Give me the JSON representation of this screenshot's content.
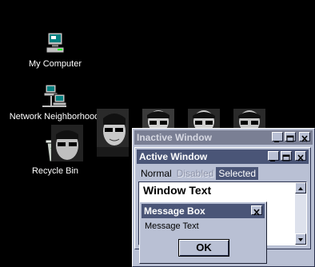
{
  "desktop": {
    "icons": [
      {
        "label": "My Computer",
        "icon": "computer-icon"
      },
      {
        "label": "Network Neighborhood",
        "icon": "network-icon"
      },
      {
        "label": "Recycle Bin",
        "icon": "recycle-bin-icon"
      }
    ],
    "background_color": "#000000"
  },
  "inactive_window": {
    "title": "Inactive Window",
    "titlebar_color": "#7a7f94"
  },
  "active_window": {
    "title": "Active Window",
    "titlebar_color": "#4a5577",
    "menu": {
      "normal": "Normal",
      "disabled": "Disabled",
      "selected": "Selected"
    },
    "window_text": "Window Text"
  },
  "message_box": {
    "title": "Message Box",
    "text": "Message Text",
    "ok_label": "OK"
  },
  "window_face_color": "#b9c0d4"
}
